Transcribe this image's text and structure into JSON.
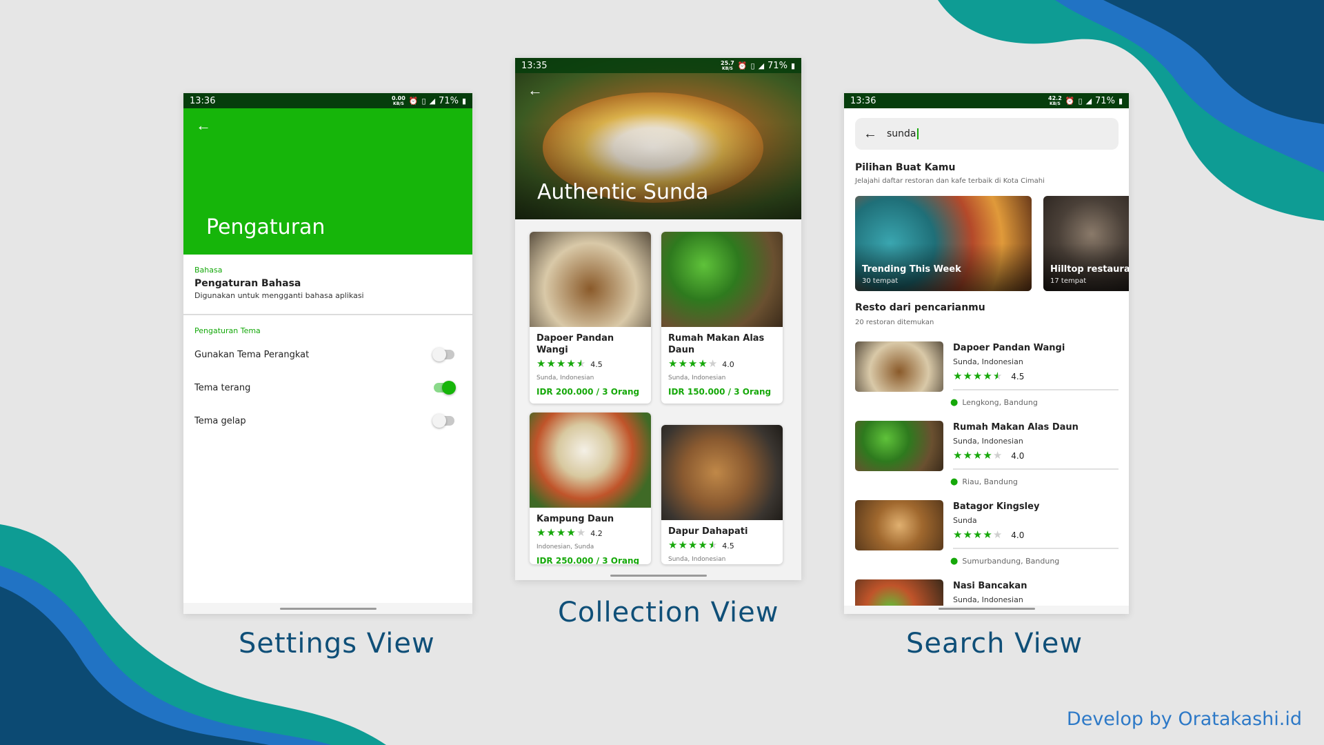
{
  "settings": {
    "status_time": "13:36",
    "status_net_top": "0.00",
    "status_net_bottom": "KB/S",
    "status_battery": "71%",
    "title": "Pengaturan",
    "language_section": "Bahasa",
    "language_title": "Pengaturan Bahasa",
    "language_sub": "Digunakan untuk mengganti bahasa aplikasi",
    "theme_section": "Pengaturan Tema",
    "toggles": [
      {
        "label": "Gunakan Tema Perangkat",
        "on": false
      },
      {
        "label": "Tema terang",
        "on": true
      },
      {
        "label": "Tema gelap",
        "on": false
      }
    ]
  },
  "collection": {
    "status_time": "13:35",
    "status_net_top": "25.7",
    "status_net_bottom": "KB/S",
    "status_battery": "71%",
    "title": "Authentic Sunda",
    "cards": [
      {
        "name": "Dapoer Pandan Wangi",
        "rating": 4.5,
        "rating_text": "4.5",
        "location": "Sunda, Indonesian",
        "price": "IDR 200.000 / 3 Orang"
      },
      {
        "name": "Rumah Makan Alas Daun",
        "rating": 4.0,
        "rating_text": "4.0",
        "location": "Sunda, Indonesian",
        "price": "IDR 150.000 / 3 Orang"
      },
      {
        "name": "Kampung Daun",
        "rating": 4.2,
        "rating_text": "4.2",
        "location": "Indonesian, Sunda",
        "price": "IDR 250.000 / 3 Orang"
      },
      {
        "name": "Dapur Dahapati",
        "rating": 4.5,
        "rating_text": "4.5",
        "location": "Sunda, Indonesian",
        "price": ""
      }
    ]
  },
  "search": {
    "status_time": "13:36",
    "status_net_top": "42.2",
    "status_net_bottom": "KB/S",
    "status_battery": "71%",
    "query": "sunda",
    "picks_title": "Pilihan Buat Kamu",
    "picks_sub": "Jelajahi daftar restoran dan kafe terbaik di Kota Cimahi",
    "tiles": [
      {
        "title": "Trending This Week",
        "sub": "30 tempat"
      },
      {
        "title": "Hilltop restaurant",
        "sub": "17 tempat"
      }
    ],
    "results_title": "Resto dari pencarianmu",
    "results_sub": "20 restoran ditemukan",
    "results": [
      {
        "name": "Dapoer Pandan Wangi",
        "category": "Sunda, Indonesian",
        "rating": 4.5,
        "rating_text": "4.5",
        "location": "Lengkong, Bandung"
      },
      {
        "name": "Rumah Makan Alas Daun",
        "category": "Sunda, Indonesian",
        "rating": 4.0,
        "rating_text": "4.0",
        "location": "Riau, Bandung"
      },
      {
        "name": "Batagor Kingsley",
        "category": "Sunda",
        "rating": 4.0,
        "rating_text": "4.0",
        "location": "Sumurbandung, Bandung"
      },
      {
        "name": "Nasi Bancakan",
        "category": "Sunda, Indonesian",
        "rating": null,
        "rating_text": "",
        "location": ""
      }
    ]
  },
  "captions": {
    "settings": "Settings View",
    "collection": "Collection View",
    "search": "Search View",
    "credit": "Develop by Oratakashi.id"
  },
  "icons": {
    "back": "back-arrow-icon",
    "star": "star-icon",
    "pin": "location-pin-icon",
    "alarm": "alarm-icon",
    "vibrate": "vibrate-icon",
    "signal": "signal-icon",
    "battery": "battery-icon"
  },
  "colors": {
    "accent_green": "#16b50a",
    "status_bar": "#063d0c",
    "caption_blue": "#0f4f78",
    "credit_blue": "#2d79c7",
    "blob_navy": "#0c4a73",
    "blob_teal": "#0e9c94",
    "blob_blue": "#2173c4"
  }
}
